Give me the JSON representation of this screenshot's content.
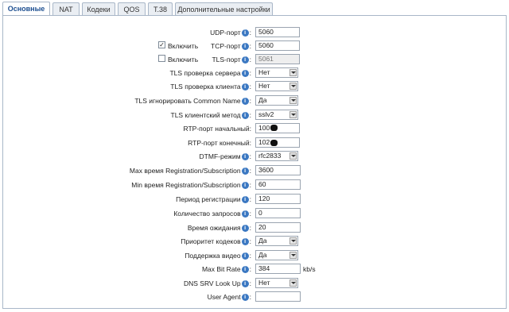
{
  "tabs": [
    {
      "label": "Основные",
      "active": true
    },
    {
      "label": "NAT"
    },
    {
      "label": "Кодеки"
    },
    {
      "label": "QOS"
    },
    {
      "label": "T.38"
    },
    {
      "label": "Дополнительные настройки"
    }
  ],
  "form": {
    "enable_label": "Включить",
    "tcp_checked": "✓",
    "tls_checked": "",
    "unit_kbs": "kb/s",
    "colon": ":",
    "info_glyph": "i",
    "rows": [
      {
        "label": "UDP-порт",
        "value": "5060"
      },
      {
        "label": "TCP-порт",
        "value": "5060"
      },
      {
        "label": "TLS-порт",
        "value": "5061"
      },
      {
        "label": "TLS проверка сервера",
        "value": "Нет"
      },
      {
        "label": "TLS проверка клиента",
        "value": "Нет"
      },
      {
        "label": "TLS игнорировать Common Name",
        "value": "Да"
      },
      {
        "label": "TLS клиентский метод",
        "value": "sslv2"
      },
      {
        "label": "RTP-порт начальный:",
        "value": "100"
      },
      {
        "label": "RTP-порт конечный:",
        "value": "102"
      },
      {
        "label": "DTMF-режим",
        "value": "rfc2833"
      },
      {
        "label": "Max время Registration/Subscription",
        "value": "3600"
      },
      {
        "label": "Min время Registration/Subscription",
        "value": "60"
      },
      {
        "label": "Период регистрации",
        "value": "120"
      },
      {
        "label": "Количество запросов",
        "value": "0"
      },
      {
        "label": "Время ожидания",
        "value": "20"
      },
      {
        "label": "Приоритет кодеков",
        "value": "Да"
      },
      {
        "label": "Поддержка видео",
        "value": "Да"
      },
      {
        "label": "Max Bit Rate",
        "value": "384"
      },
      {
        "label": "DNS SRV Look Up",
        "value": "Нет"
      },
      {
        "label": "User Agent",
        "value": ""
      }
    ]
  }
}
